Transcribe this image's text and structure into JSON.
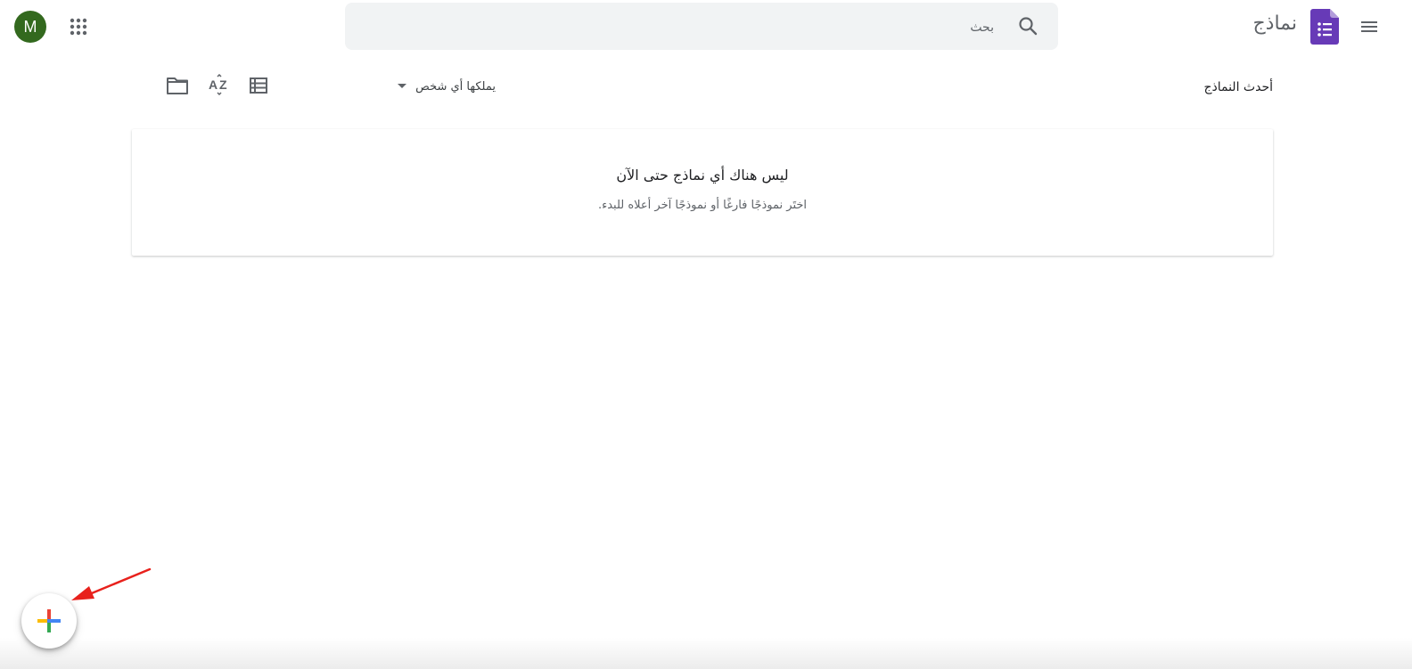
{
  "header": {
    "app_name": "نماذج",
    "search": {
      "placeholder": "بحث",
      "value": ""
    },
    "avatar_letter": "M"
  },
  "toolbar": {
    "section_title": "أحدث النماذج",
    "owner_filter": "يملكها أي شخص"
  },
  "empty_state": {
    "title": "ليس هناك أي نماذج حتى الآن",
    "subtitle": "اختَر نموذجًا فارغًا أو نموذجًا آخر أعلاه للبدء."
  },
  "icons": {
    "menu": "hamburger-menu-icon",
    "logo": "google-forms-logo",
    "search": "search-icon",
    "apps": "apps-grid-icon",
    "list_view": "list-view-icon",
    "sort": "sort-az-icon",
    "folder": "folder-icon",
    "add": "add-plus-icon"
  },
  "colors": {
    "forms_purple": "#673ab7",
    "avatar_green": "#33691e",
    "search_bg": "#f1f3f4",
    "annotation_red": "#e8211c",
    "plus_blue": "#4285f4",
    "plus_red": "#ea4335",
    "plus_yellow": "#fbbc04",
    "plus_green": "#34a853"
  }
}
